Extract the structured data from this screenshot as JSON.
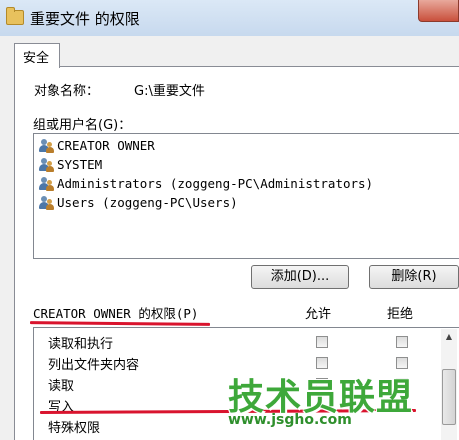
{
  "window": {
    "title": "重要文件 的权限"
  },
  "tabs": [
    {
      "label": "安全"
    }
  ],
  "object": {
    "label": "对象名称：",
    "value": "G:\\重要文件"
  },
  "groups": {
    "label": "组或用户名(G)：",
    "users": [
      "CREATOR OWNER",
      "SYSTEM",
      "Administrators (zoggeng-PC\\Administrators)",
      "Users (zoggeng-PC\\Users)"
    ]
  },
  "buttons": {
    "add": "添加(D)...",
    "remove": "删除(R)"
  },
  "permissions": {
    "label": "CREATOR OWNER 的权限(P)",
    "allow_header": "允许",
    "deny_header": "拒绝",
    "items": [
      "读取和执行",
      "列出文件夹内容",
      "读取",
      "写入",
      "特殊权限"
    ]
  },
  "watermark": {
    "brand": "技术员联盟",
    "url": "www.jsgho.com"
  },
  "colors": {
    "annotation_red": "#d9142e",
    "watermark_green": "#3ea83a"
  }
}
